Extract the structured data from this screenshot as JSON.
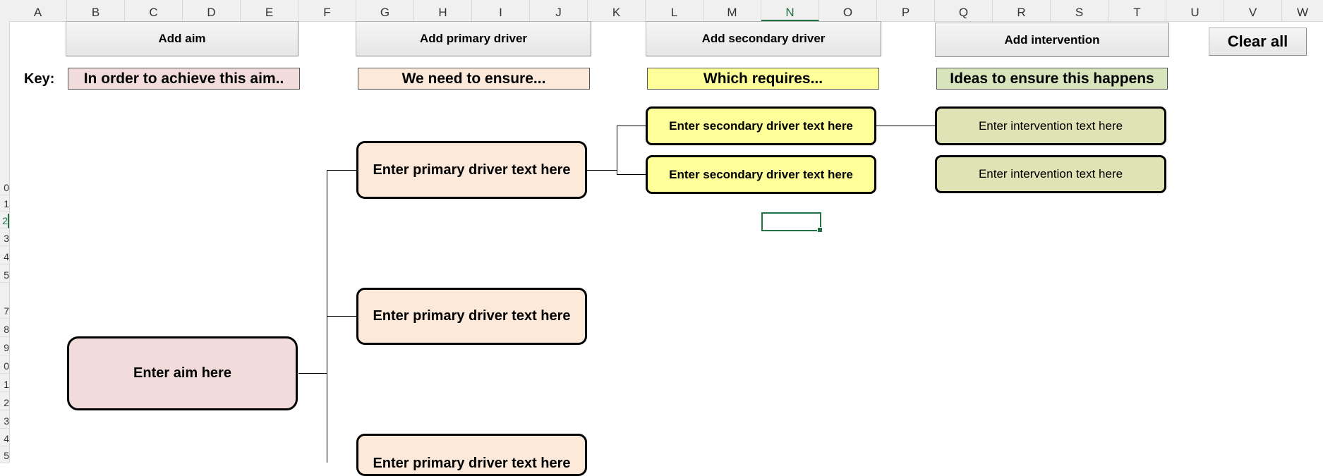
{
  "columns": [
    "A",
    "B",
    "C",
    "D",
    "E",
    "F",
    "G",
    "H",
    "I",
    "J",
    "K",
    "L",
    "M",
    "N",
    "O",
    "P",
    "Q",
    "R",
    "S",
    "T",
    "U",
    "V",
    "W"
  ],
  "selected_column": "N",
  "rows": [
    "0",
    "1",
    "2",
    "3",
    "4",
    "5",
    "7",
    "8",
    "9",
    "0",
    "1",
    "2",
    "3",
    "4",
    "5"
  ],
  "selected_row_index": 2,
  "buttons": {
    "add_aim": "Add aim",
    "add_primary": "Add primary driver",
    "add_secondary": "Add secondary driver",
    "add_intervention": "Add intervention",
    "clear_all": "Clear all"
  },
  "key": {
    "label": "Key:",
    "aim": "In order to achieve this aim..",
    "primary": "We need to ensure...",
    "secondary": "Which requires...",
    "intervention": "Ideas to ensure this happens"
  },
  "diagram": {
    "aim": "Enter aim here",
    "primary_drivers": [
      "Enter primary driver text here",
      "Enter primary driver text here",
      "Enter primary driver text here"
    ],
    "secondary_drivers": [
      "Enter secondary driver text here",
      "Enter secondary driver text here"
    ],
    "interventions": [
      "Enter intervention text here",
      "Enter intervention text here"
    ]
  },
  "colors": {
    "aim": "#f2dcdb",
    "primary": "#fde9d9",
    "secondary": "#ffff99",
    "intervention": "#dfe3b6",
    "excel_green": "#217346"
  }
}
